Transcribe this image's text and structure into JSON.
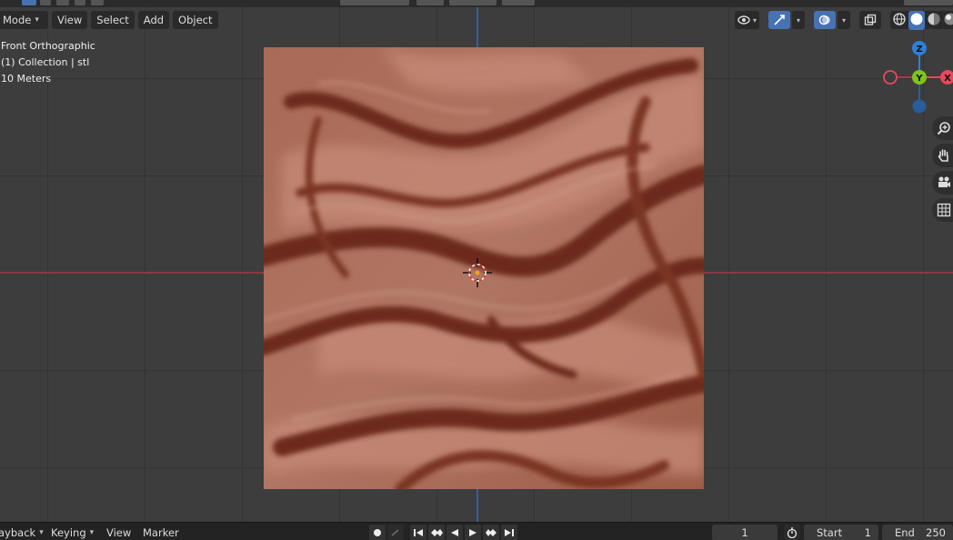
{
  "header": {
    "mode_label": "Mode",
    "menu": [
      "View",
      "Select",
      "Add",
      "Object"
    ]
  },
  "viewport_info": {
    "view_name": "Front Orthographic",
    "collection": "(1) Collection | stl",
    "scale": "10 Meters"
  },
  "gizmo": {
    "axes": [
      {
        "label": "Z",
        "color": "#2f7fd8"
      },
      {
        "label": "Y",
        "color": "#7fc31d"
      },
      {
        "label": "X",
        "color": "#e8485e"
      }
    ],
    "negative_colors": [
      "#a63a49",
      "#2a5d9c"
    ]
  },
  "right_toolbar": {
    "icons": [
      "visibility-icon",
      "gizmo-toggle-icon",
      "overlay-toggle-icon",
      "xray-icon",
      "wireframe-shading-icon",
      "solid-shading-icon",
      "material-shading-icon",
      "rendered-shading-icon"
    ]
  },
  "nav_icons": [
    "zoom-icon",
    "pan-hand-icon",
    "camera-icon",
    "grid-perspective-icon"
  ],
  "colors": {
    "plane_base": "#a46550",
    "plane_dark": "#6b2b1a",
    "plane_light": "#c48876",
    "axis_x": "#8a3843",
    "axis_z": "#2f63a8",
    "accent": "#4772b3"
  },
  "timeline": {
    "playback_label": "ayback",
    "keying_label": "Keying",
    "view_label": "View",
    "marker_label": "Marker",
    "current_frame": "1",
    "start_label": "Start",
    "start_value": "1",
    "end_label": "End",
    "end_value": "250"
  }
}
